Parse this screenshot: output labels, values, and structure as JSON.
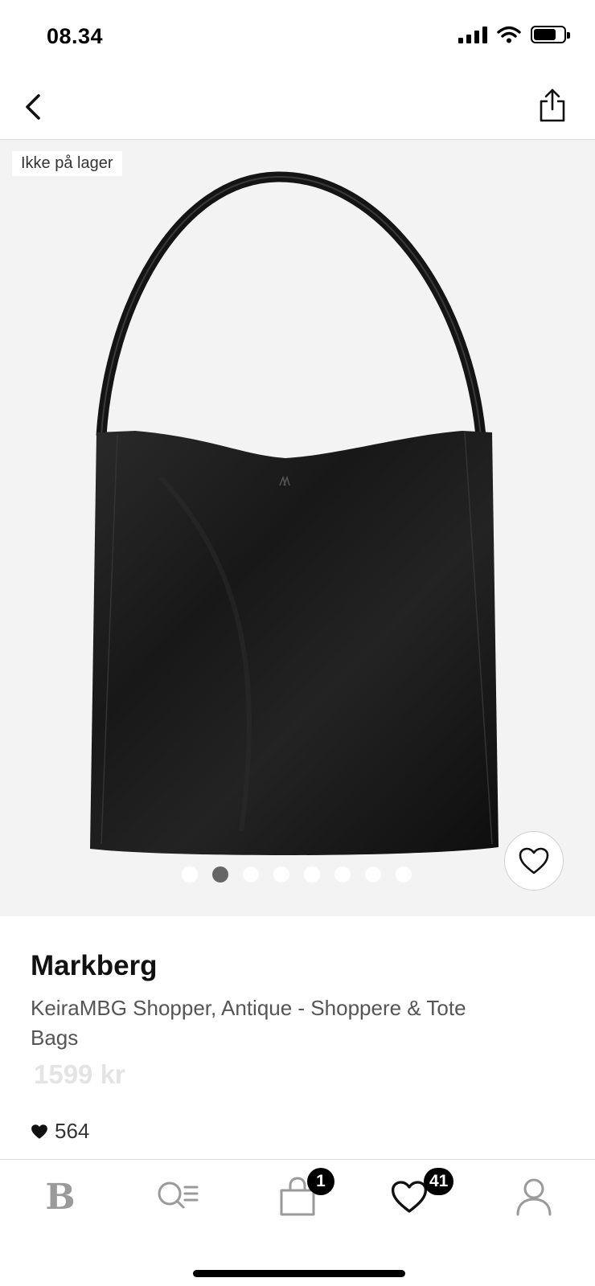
{
  "status_bar": {
    "time": "08.34",
    "icons": [
      "cellular-signal-icon",
      "wifi-icon",
      "battery-icon"
    ],
    "battery_level": 0.75
  },
  "nav": {
    "back_icon": "chevron-left-icon",
    "share_icon": "share-icon"
  },
  "gallery": {
    "stock_label": "Ikke på lager",
    "image_count": 8,
    "active_index": 1,
    "wishlist_icon": "heart-outline-icon"
  },
  "product": {
    "brand": "Markberg",
    "name": "KeiraMBG Shopper, Antique - Shoppere & Tote Bags",
    "price": "1599 kr",
    "likes": "564"
  },
  "tab_bar": {
    "items": [
      {
        "name": "home",
        "icon": "brand-logo-icon",
        "label": "B"
      },
      {
        "name": "search",
        "icon": "search-list-icon"
      },
      {
        "name": "cart",
        "icon": "shopping-bag-icon",
        "badge": "1"
      },
      {
        "name": "wishlist",
        "icon": "heart-icon",
        "badge": "41"
      },
      {
        "name": "profile",
        "icon": "user-icon"
      }
    ]
  },
  "colors": {
    "background": "#ffffff",
    "gallery_background": "#f3f3f3",
    "badge_background": "#000000",
    "price_text": "#e4e4e4"
  }
}
